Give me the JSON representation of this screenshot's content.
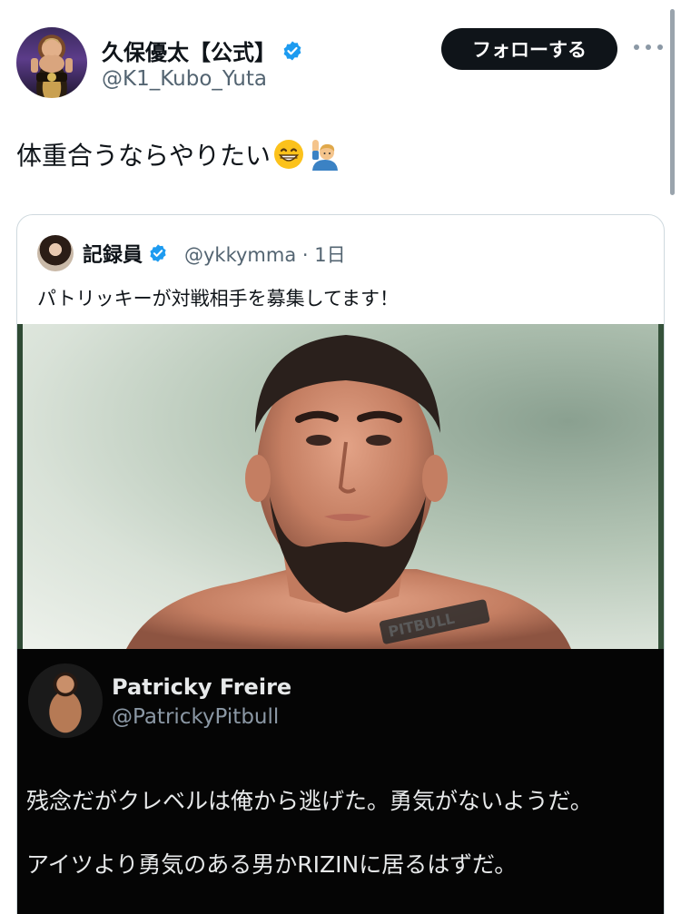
{
  "author": {
    "display_name": "久保優太【公式】",
    "handle": "@K1_Kubo_Yuta",
    "avatar_icon": "profile-photo-icon",
    "verified_icon": "verified-badge-icon",
    "verified_color": "#1d9bf0"
  },
  "actions": {
    "follow_label": "フォローする",
    "more_icon": "more-dots-icon"
  },
  "tweet": {
    "text": "体重合うならやりたい",
    "emojis": [
      "grinning-face-emoji",
      "person-raising-hand-emoji"
    ]
  },
  "quoted": {
    "display_name": "記録員",
    "handle_time": "@ykkymma · 1日",
    "text": "パトリッキーが対戦相手を募集してます！",
    "media": {
      "photo_icon": "fighter-photo",
      "tattoo_text": "PITBULL",
      "embedded_post": {
        "display_name": "Patricky Freire",
        "handle": "@PatrickyPitbull",
        "line1": "残念だがクレベルは俺から逃げた。勇気がないようだ。",
        "line2": "アイツより勇気のある男かRIZINに居るはずだ。"
      }
    }
  }
}
